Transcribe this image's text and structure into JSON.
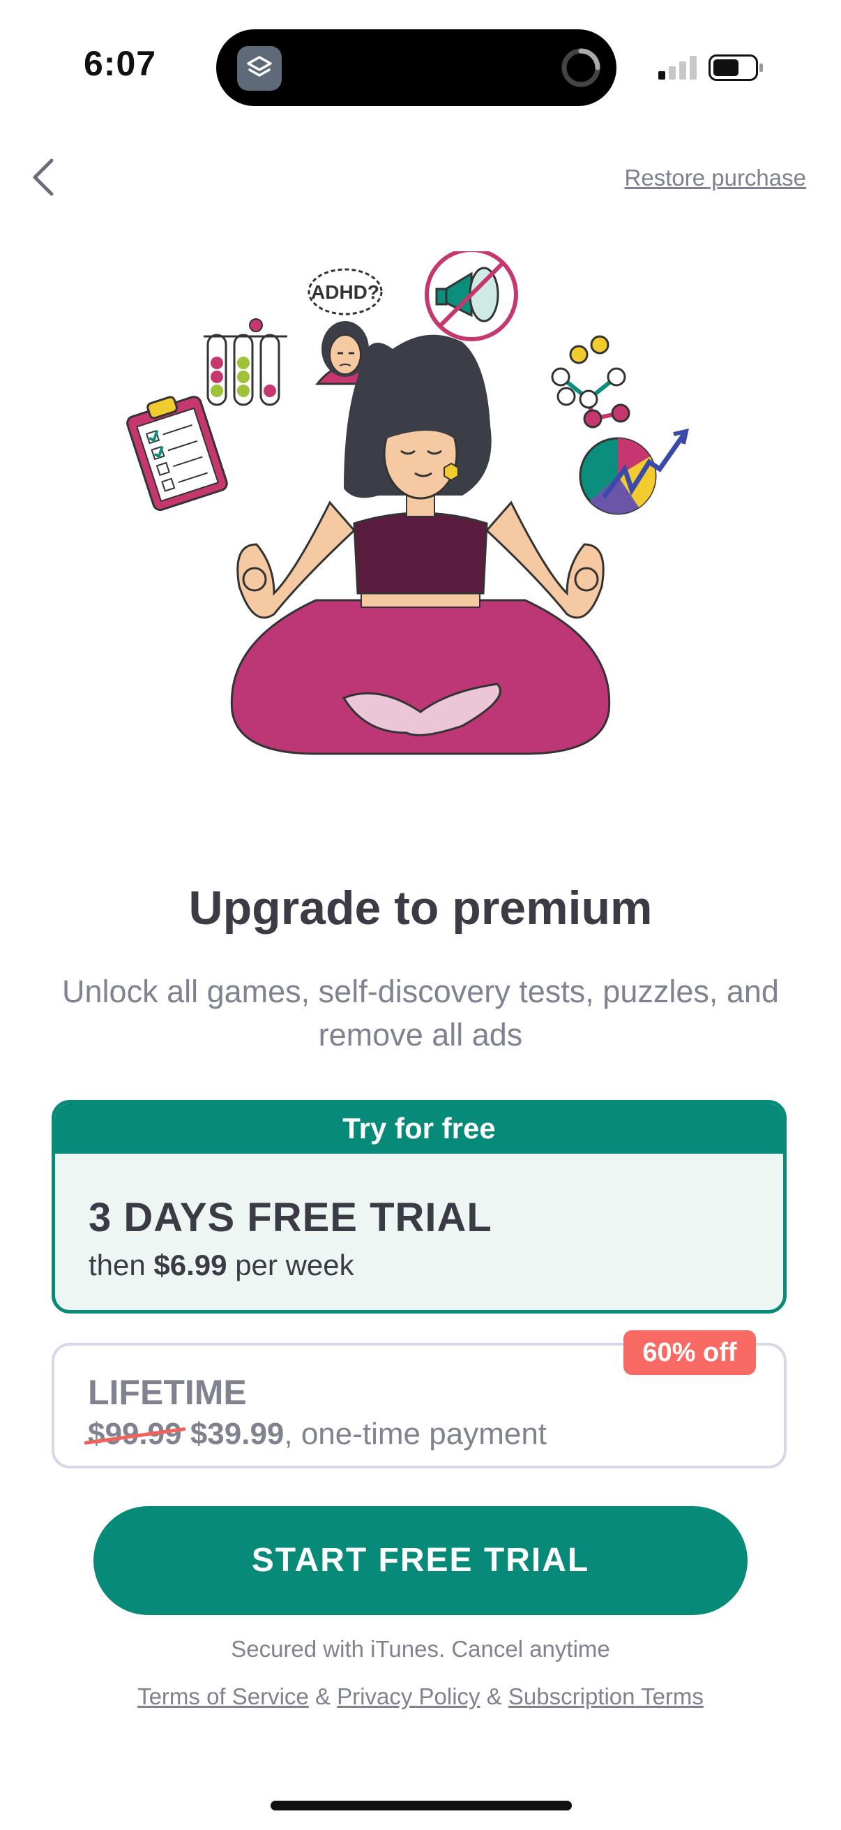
{
  "status_bar": {
    "time": "6:07"
  },
  "nav": {
    "restore_label": "Restore purchase"
  },
  "illustration": {
    "adhd_label": "ADHD?"
  },
  "heading": {
    "title": "Upgrade to premium",
    "subtitle": "Unlock all games, self-discovery tests, puzzles, and remove all ads"
  },
  "plans": {
    "trial": {
      "header": "Try for free",
      "name": "3 DAYS FREE TRIAL",
      "then": "then",
      "price": "$6.99",
      "period": "per week"
    },
    "lifetime": {
      "badge": "60% off",
      "name": "LIFETIME",
      "old_price": "$99.99",
      "price": "$39.99",
      "suffix": ", one-time payment"
    }
  },
  "cta": {
    "label": "START FREE TRIAL"
  },
  "footer": {
    "secured": "Secured with iTunes. Cancel anytime",
    "terms": "Terms of Service",
    "privacy": "Privacy Policy",
    "subscription": "Subscription Terms",
    "separator": "&"
  },
  "colors": {
    "accent": "#078b78",
    "badge": "#f86a63",
    "text": "#3a3b44",
    "muted": "#80838f"
  }
}
